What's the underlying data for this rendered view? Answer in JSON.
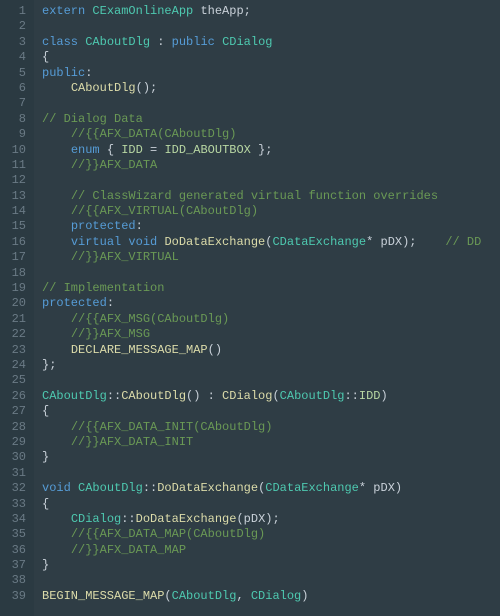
{
  "editor": {
    "lines": [
      {
        "n": 1,
        "tokens": [
          [
            "keyword",
            "extern "
          ],
          [
            "type",
            "CExamOnlineApp"
          ],
          [
            "plain",
            " theApp"
          ],
          [
            "punct",
            ";"
          ]
        ]
      },
      {
        "n": 2,
        "tokens": []
      },
      {
        "n": 3,
        "tokens": [
          [
            "keyword",
            "class "
          ],
          [
            "type",
            "CAboutDlg"
          ],
          [
            "plain",
            " "
          ],
          [
            "punct",
            ":"
          ],
          [
            "plain",
            " "
          ],
          [
            "keyword",
            "public "
          ],
          [
            "type",
            "CDialog"
          ]
        ]
      },
      {
        "n": 4,
        "tokens": [
          [
            "punct",
            "{"
          ]
        ]
      },
      {
        "n": 5,
        "tokens": [
          [
            "keyword",
            "public"
          ],
          [
            "punct",
            ":"
          ]
        ]
      },
      {
        "n": 6,
        "tokens": [
          [
            "plain",
            "    "
          ],
          [
            "func",
            "CAboutDlg"
          ],
          [
            "punct",
            "();"
          ]
        ]
      },
      {
        "n": 7,
        "tokens": []
      },
      {
        "n": 8,
        "tokens": [
          [
            "comment",
            "// Dialog Data"
          ]
        ]
      },
      {
        "n": 9,
        "tokens": [
          [
            "plain",
            "    "
          ],
          [
            "comment",
            "//{{AFX_DATA(CAboutDlg)"
          ]
        ]
      },
      {
        "n": 10,
        "tokens": [
          [
            "plain",
            "    "
          ],
          [
            "keyword",
            "enum"
          ],
          [
            "plain",
            " "
          ],
          [
            "punct",
            "{"
          ],
          [
            "plain",
            " "
          ],
          [
            "enumval",
            "IDD"
          ],
          [
            "plain",
            " "
          ],
          [
            "punct",
            "="
          ],
          [
            "plain",
            " "
          ],
          [
            "enumval",
            "IDD_ABOUTBOX"
          ],
          [
            "plain",
            " "
          ],
          [
            "punct",
            "};"
          ]
        ]
      },
      {
        "n": 11,
        "tokens": [
          [
            "plain",
            "    "
          ],
          [
            "comment",
            "//}}AFX_DATA"
          ]
        ]
      },
      {
        "n": 12,
        "tokens": []
      },
      {
        "n": 13,
        "tokens": [
          [
            "plain",
            "    "
          ],
          [
            "comment",
            "// ClassWizard generated virtual function overrides"
          ]
        ]
      },
      {
        "n": 14,
        "tokens": [
          [
            "plain",
            "    "
          ],
          [
            "comment",
            "//{{AFX_VIRTUAL(CAboutDlg)"
          ]
        ]
      },
      {
        "n": 15,
        "tokens": [
          [
            "plain",
            "    "
          ],
          [
            "keyword",
            "protected"
          ],
          [
            "punct",
            ":"
          ]
        ]
      },
      {
        "n": 16,
        "tokens": [
          [
            "plain",
            "    "
          ],
          [
            "keyword",
            "virtual "
          ],
          [
            "keyword",
            "void"
          ],
          [
            "plain",
            " "
          ],
          [
            "func",
            "DoDataExchange"
          ],
          [
            "punct",
            "("
          ],
          [
            "type",
            "CDataExchange"
          ],
          [
            "punct",
            "*"
          ],
          [
            "plain",
            " pDX"
          ],
          [
            "punct",
            ");"
          ],
          [
            "plain",
            "    "
          ],
          [
            "comment",
            "// DD"
          ]
        ]
      },
      {
        "n": 17,
        "tokens": [
          [
            "plain",
            "    "
          ],
          [
            "comment",
            "//}}AFX_VIRTUAL"
          ]
        ]
      },
      {
        "n": 18,
        "tokens": []
      },
      {
        "n": 19,
        "tokens": [
          [
            "comment",
            "// Implementation"
          ]
        ]
      },
      {
        "n": 20,
        "tokens": [
          [
            "keyword",
            "protected"
          ],
          [
            "punct",
            ":"
          ]
        ]
      },
      {
        "n": 21,
        "tokens": [
          [
            "plain",
            "    "
          ],
          [
            "comment",
            "//{{AFX_MSG(CAboutDlg)"
          ]
        ]
      },
      {
        "n": 22,
        "tokens": [
          [
            "plain",
            "    "
          ],
          [
            "comment",
            "//}}AFX_MSG"
          ]
        ]
      },
      {
        "n": 23,
        "tokens": [
          [
            "plain",
            "    "
          ],
          [
            "func",
            "DECLARE_MESSAGE_MAP"
          ],
          [
            "punct",
            "()"
          ]
        ]
      },
      {
        "n": 24,
        "tokens": [
          [
            "punct",
            "};"
          ]
        ]
      },
      {
        "n": 25,
        "tokens": []
      },
      {
        "n": 26,
        "tokens": [
          [
            "type",
            "CAboutDlg"
          ],
          [
            "punct",
            "::"
          ],
          [
            "func",
            "CAboutDlg"
          ],
          [
            "punct",
            "()"
          ],
          [
            "plain",
            " "
          ],
          [
            "punct",
            ":"
          ],
          [
            "plain",
            " "
          ],
          [
            "func",
            "CDialog"
          ],
          [
            "punct",
            "("
          ],
          [
            "type",
            "CAboutDlg"
          ],
          [
            "punct",
            "::"
          ],
          [
            "enumval",
            "IDD"
          ],
          [
            "punct",
            ")"
          ]
        ]
      },
      {
        "n": 27,
        "tokens": [
          [
            "punct",
            "{"
          ]
        ]
      },
      {
        "n": 28,
        "tokens": [
          [
            "plain",
            "    "
          ],
          [
            "comment",
            "//{{AFX_DATA_INIT(CAboutDlg)"
          ]
        ]
      },
      {
        "n": 29,
        "tokens": [
          [
            "plain",
            "    "
          ],
          [
            "comment",
            "//}}AFX_DATA_INIT"
          ]
        ]
      },
      {
        "n": 30,
        "tokens": [
          [
            "punct",
            "}"
          ]
        ]
      },
      {
        "n": 31,
        "tokens": []
      },
      {
        "n": 32,
        "tokens": [
          [
            "keyword",
            "void"
          ],
          [
            "plain",
            " "
          ],
          [
            "type",
            "CAboutDlg"
          ],
          [
            "punct",
            "::"
          ],
          [
            "func",
            "DoDataExchange"
          ],
          [
            "punct",
            "("
          ],
          [
            "type",
            "CDataExchange"
          ],
          [
            "punct",
            "*"
          ],
          [
            "plain",
            " pDX"
          ],
          [
            "punct",
            ")"
          ]
        ]
      },
      {
        "n": 33,
        "tokens": [
          [
            "punct",
            "{"
          ]
        ]
      },
      {
        "n": 34,
        "tokens": [
          [
            "plain",
            "    "
          ],
          [
            "type",
            "CDialog"
          ],
          [
            "punct",
            "::"
          ],
          [
            "func",
            "DoDataExchange"
          ],
          [
            "punct",
            "("
          ],
          [
            "plain",
            "pDX"
          ],
          [
            "punct",
            ");"
          ]
        ]
      },
      {
        "n": 35,
        "tokens": [
          [
            "plain",
            "    "
          ],
          [
            "comment",
            "//{{AFX_DATA_MAP(CAboutDlg)"
          ]
        ]
      },
      {
        "n": 36,
        "tokens": [
          [
            "plain",
            "    "
          ],
          [
            "comment",
            "//}}AFX_DATA_MAP"
          ]
        ]
      },
      {
        "n": 37,
        "tokens": [
          [
            "punct",
            "}"
          ]
        ]
      },
      {
        "n": 38,
        "tokens": []
      },
      {
        "n": 39,
        "tokens": [
          [
            "func",
            "BEGIN_MESSAGE_MAP"
          ],
          [
            "punct",
            "("
          ],
          [
            "type",
            "CAboutDlg"
          ],
          [
            "punct",
            ", "
          ],
          [
            "type",
            "CDialog"
          ],
          [
            "punct",
            ")"
          ]
        ]
      }
    ]
  }
}
